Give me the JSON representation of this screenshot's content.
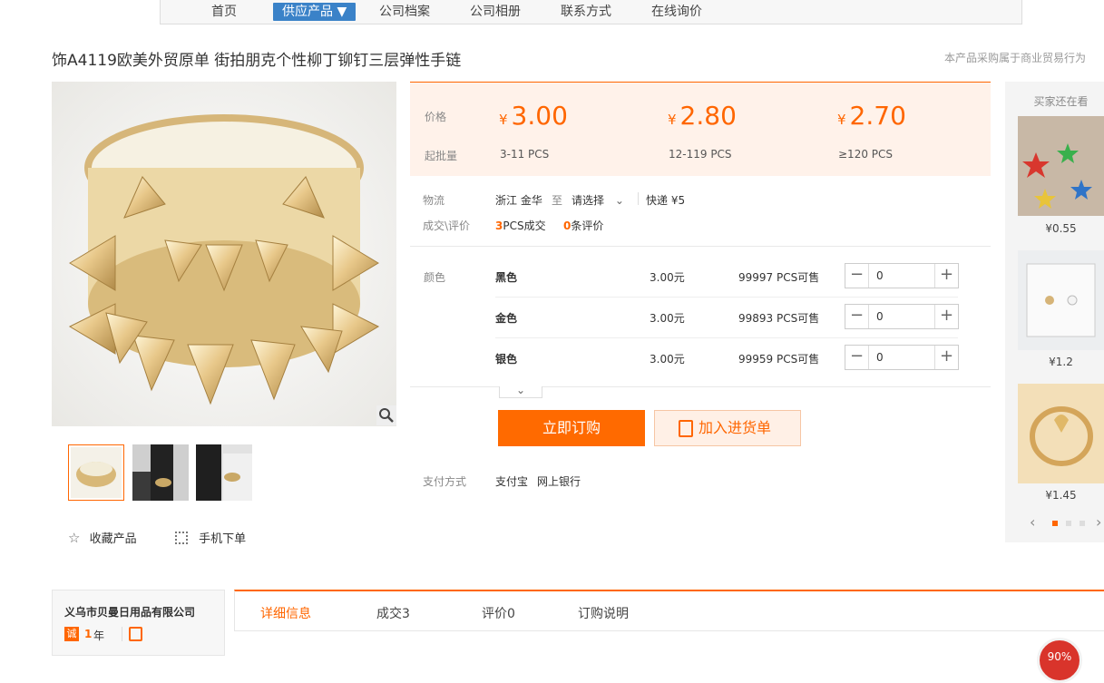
{
  "nav": {
    "items": [
      "首页",
      "供应产品 ▼",
      "公司档案",
      "公司相册",
      "联系方式",
      "在线询价"
    ]
  },
  "product": {
    "title": "饰A4119欧美外贸原单 街拍朋克个性柳丁铆钉三层弹性手链",
    "note": "本产品采购属于商业贸易行为"
  },
  "pricing": {
    "price_label": "价格",
    "qty_label": "起批量",
    "yen": "¥",
    "tiers": [
      {
        "price": "3.00",
        "qty": "3-11  PCS"
      },
      {
        "price": "2.80",
        "qty": "12-119  PCS"
      },
      {
        "price": "2.70",
        "qty": "≥120  PCS"
      }
    ]
  },
  "logistics": {
    "label": "物流",
    "from": "浙江 金华",
    "to_word": "至",
    "select": "请选择",
    "express": "快递 ¥5"
  },
  "deals": {
    "label": "成交\\评价",
    "count": "3",
    "count_text": "PCS成交",
    "reviews": "0",
    "reviews_text": "条评价"
  },
  "variants": {
    "label": "颜色",
    "rows": [
      {
        "name": "黑色",
        "price": "3.00元",
        "stock": "99997 PCS可售",
        "qty": "0"
      },
      {
        "name": "金色",
        "price": "3.00元",
        "stock": "99893 PCS可售",
        "qty": "0"
      },
      {
        "name": "银色",
        "price": "3.00元",
        "stock": "99959 PCS可售",
        "qty": "0"
      }
    ]
  },
  "actions": {
    "buy_now": "立即订购",
    "add_cart": "加入进货单"
  },
  "payment": {
    "label": "支付方式",
    "methods": [
      "支付宝",
      "网上银行"
    ]
  },
  "extras": {
    "favorite": "收藏产品",
    "mobile": "手机下单"
  },
  "side": {
    "title": "买家还在看",
    "items": [
      {
        "price": "¥0.55"
      },
      {
        "price": "¥1.2"
      },
      {
        "price": "¥1.45"
      }
    ]
  },
  "company": {
    "name": "义乌市贝曼日用品有限公司",
    "badge": "诚",
    "years": "1",
    "years_unit": "年"
  },
  "tabs": [
    "详细信息",
    "成交3",
    "评价0",
    "订购说明"
  ],
  "float_badge": "90%"
}
